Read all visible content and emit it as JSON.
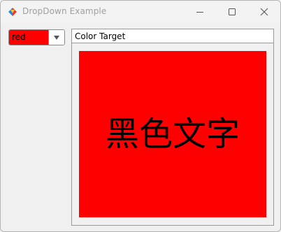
{
  "window": {
    "title": "DropDown Example"
  },
  "dropdown": {
    "value": "red",
    "selected_color": "#ff0000"
  },
  "panel": {
    "title": "Color Target",
    "text": "黑色文字",
    "fill_color": "#ff0000"
  }
}
